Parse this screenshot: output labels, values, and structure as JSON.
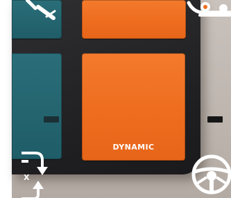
{
  "keypad": {
    "dynamic_key": {
      "label": "DYNAMIC",
      "icon": "steering-wheel-icon"
    },
    "left_key_fragment": {
      "label": "X",
      "icon": "swap-arrows-icon"
    },
    "top_left_key": {
      "icon": "wrench-icon"
    },
    "top_right_key": {
      "icon": "mixer-icon"
    }
  },
  "colors": {
    "orange_key": "#ef6e20",
    "teal_key": "#236470",
    "keypad_body": "#252527",
    "symbol": "#ffffff"
  }
}
